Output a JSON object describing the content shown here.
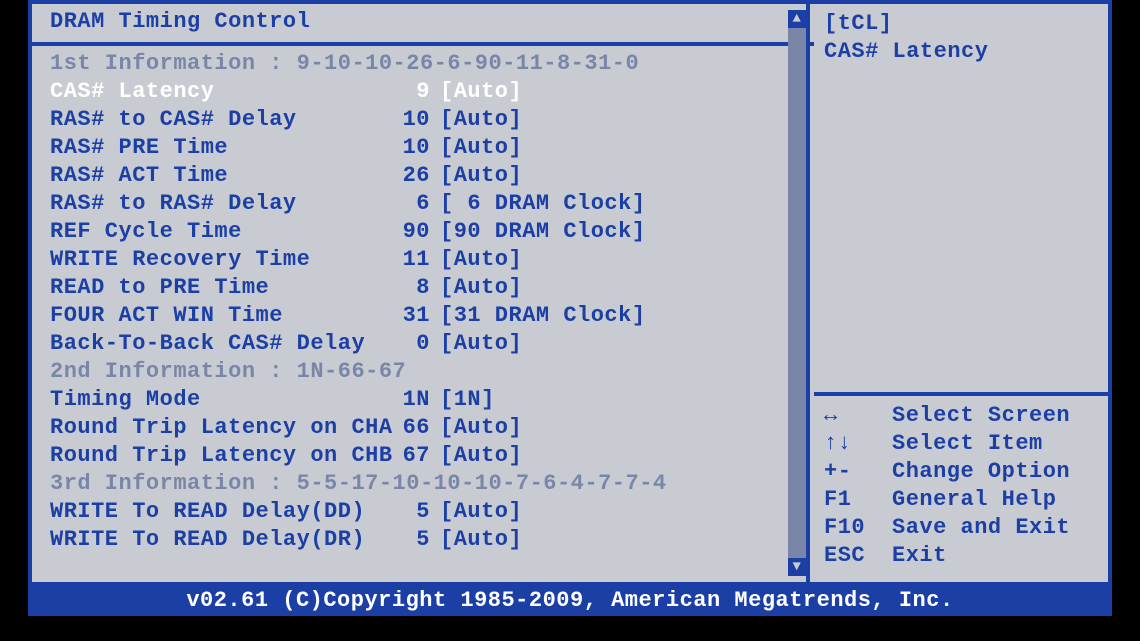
{
  "title": "DRAM Timing Control",
  "info_headers": {
    "first": "1st Information : 9-10-10-26-6-90-11-8-31-0",
    "second": "2nd Information : 1N-66-67",
    "third": "3rd Information : 5-5-17-10-10-10-7-6-4-7-7-4"
  },
  "settings1": [
    {
      "label": "CAS# Latency",
      "val": "9",
      "opt": "[Auto]",
      "selected": true
    },
    {
      "label": "RAS# to CAS# Delay",
      "val": "10",
      "opt": "[Auto]"
    },
    {
      "label": "RAS# PRE Time",
      "val": "10",
      "opt": "[Auto]"
    },
    {
      "label": "RAS# ACT Time",
      "val": "26",
      "opt": "[Auto]"
    },
    {
      "label": "RAS# to RAS# Delay",
      "val": "6",
      "opt": "[ 6 DRAM Clock]"
    },
    {
      "label": "REF Cycle Time",
      "val": "90",
      "opt": "[90 DRAM Clock]"
    },
    {
      "label": "WRITE Recovery Time",
      "val": "11",
      "opt": "[Auto]"
    },
    {
      "label": "READ to PRE Time",
      "val": "8",
      "opt": "[Auto]"
    },
    {
      "label": "FOUR ACT WIN Time",
      "val": "31",
      "opt": "[31 DRAM Clock]"
    },
    {
      "label": "Back-To-Back CAS# Delay",
      "val": "0",
      "opt": "[Auto]"
    }
  ],
  "settings2": [
    {
      "label": "Timing Mode",
      "val": "1N",
      "opt": "[1N]"
    },
    {
      "label": "Round Trip Latency on CHA",
      "val": "66",
      "opt": "[Auto]"
    },
    {
      "label": "Round Trip Latency on CHB",
      "val": "67",
      "opt": "[Auto]"
    }
  ],
  "settings3": [
    {
      "label": "WRITE To READ Delay(DD)",
      "val": "5",
      "opt": "[Auto]"
    },
    {
      "label": "WRITE To READ Delay(DR)",
      "val": "5",
      "opt": "[Auto]"
    }
  ],
  "side": {
    "hint1": "[tCL]",
    "hint2": "CAS# Latency",
    "help": [
      {
        "key": "↔",
        "text": "Select Screen"
      },
      {
        "key": "↑↓",
        "text": "Select Item"
      },
      {
        "key": "+-",
        "text": "Change Option"
      },
      {
        "key": "F1",
        "text": "General Help"
      },
      {
        "key": "F10",
        "text": "Save and Exit"
      },
      {
        "key": "ESC",
        "text": "Exit"
      }
    ]
  },
  "footer": "v02.61 (C)Copyright 1985-2009, American Megatrends, Inc."
}
